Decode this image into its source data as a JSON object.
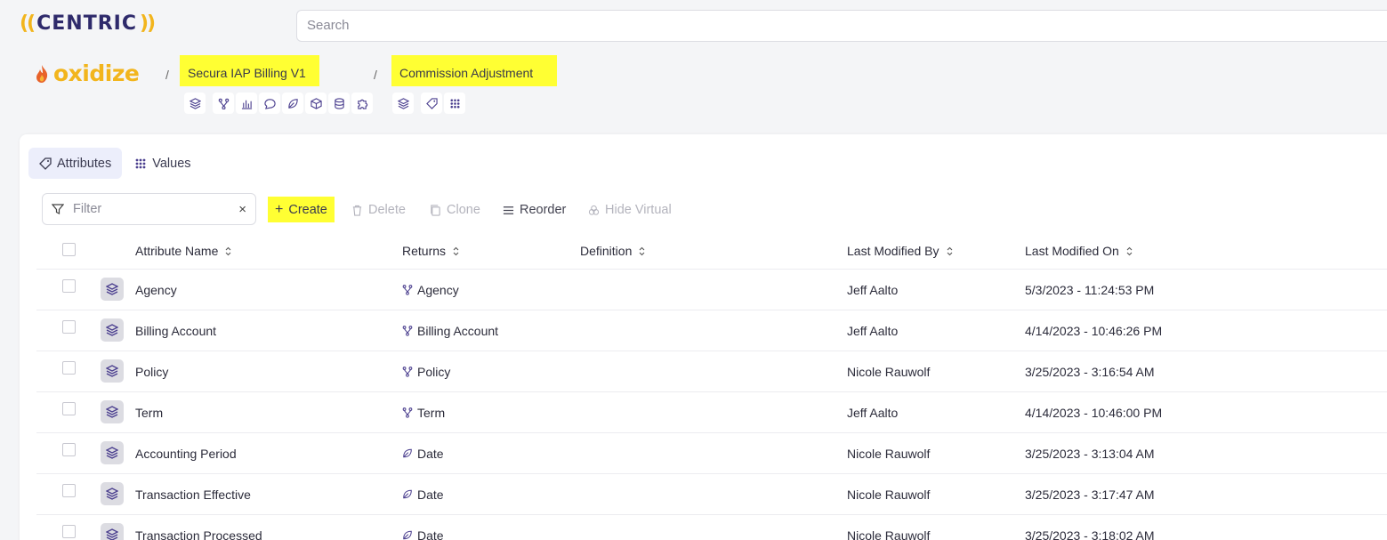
{
  "header": {
    "logo_text": "CENTRIC",
    "logo_paren_left": "((",
    "logo_paren_right": "))",
    "search_placeholder": "Search"
  },
  "breadcrumb": {
    "brand": "oxidize",
    "separator": "/",
    "project": "Secura IAP Billing V1",
    "entity": "Commission Adjustment"
  },
  "tabs": [
    {
      "label": "Attributes",
      "active": true
    },
    {
      "label": "Values",
      "active": false
    }
  ],
  "toolbar": {
    "filter_placeholder": "Filter",
    "clear": "×",
    "create": "Create",
    "delete": "Delete",
    "clone": "Clone",
    "reorder": "Reorder",
    "hide_virtual": "Hide Virtual"
  },
  "table": {
    "columns": [
      "Attribute Name",
      "Returns",
      "Definition",
      "Last Modified By",
      "Last Modified On"
    ],
    "rows": [
      {
        "name": "Agency",
        "returns": "Agency",
        "returns_icon": "relation-icon",
        "definition": "",
        "by": "Jeff Aalto",
        "on": "5/3/2023 - 11:24:53 PM"
      },
      {
        "name": "Billing Account",
        "returns": "Billing Account",
        "returns_icon": "relation-icon",
        "definition": "",
        "by": "Jeff Aalto",
        "on": "4/14/2023 - 10:46:26 PM"
      },
      {
        "name": "Policy",
        "returns": "Policy",
        "returns_icon": "relation-icon",
        "definition": "",
        "by": "Nicole Rauwolf",
        "on": "3/25/2023 - 3:16:54 AM"
      },
      {
        "name": "Term",
        "returns": "Term",
        "returns_icon": "relation-icon",
        "definition": "",
        "by": "Jeff Aalto",
        "on": "4/14/2023 - 10:46:00 PM"
      },
      {
        "name": "Accounting Period",
        "returns": "Date",
        "returns_icon": "leaf-icon",
        "definition": "",
        "by": "Nicole Rauwolf",
        "on": "3/25/2023 - 3:13:04 AM"
      },
      {
        "name": "Transaction Effective",
        "returns": "Date",
        "returns_icon": "leaf-icon",
        "definition": "",
        "by": "Nicole Rauwolf",
        "on": "3/25/2023 - 3:17:47 AM"
      },
      {
        "name": "Transaction Processed",
        "returns": "Date",
        "returns_icon": "leaf-icon",
        "definition": "",
        "by": "Nicole Rauwolf",
        "on": "3/25/2023 - 3:18:02 AM"
      }
    ]
  },
  "colors": {
    "brand_yellow": "#f2b51d",
    "brand_navy": "#2e2a6b",
    "highlight": "#ffff33",
    "icon_purple": "#4b3f8f"
  }
}
